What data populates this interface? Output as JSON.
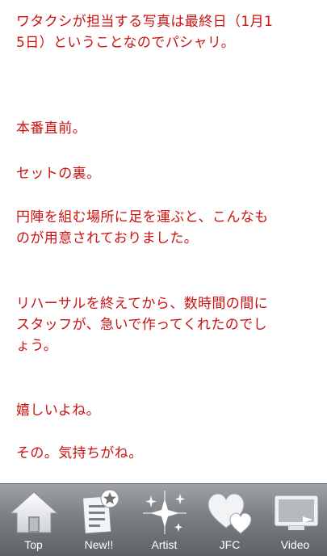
{
  "content": {
    "paragraphs": [
      "ワタクシが担当する写真は最終日（1月1\n5日）ということなのでパシャリ。",
      "本番直前。",
      "セットの裏。",
      "円陣を組む場所に足を運ぶと、こんなも\nのが用意されておりました。",
      "リハーサルを終えてから、数時間の間に\nスタッフが、急いで作ってくれたのでし\nょう。",
      "嬉しいよね。",
      "その。気持ちがね。"
    ]
  },
  "tabbar": {
    "tabs": [
      {
        "label": "Top",
        "icon": "home-icon"
      },
      {
        "label": "New!!",
        "icon": "new-post-icon"
      },
      {
        "label": "Artist",
        "icon": "sparkle-icon"
      },
      {
        "label": "JFC",
        "icon": "hearts-icon"
      },
      {
        "label": "Video",
        "icon": "video-screen-icon"
      }
    ]
  },
  "colors": {
    "text": "#cc1111",
    "tabbar_background": "#7b7f84",
    "tab_label": "#ffffff"
  }
}
